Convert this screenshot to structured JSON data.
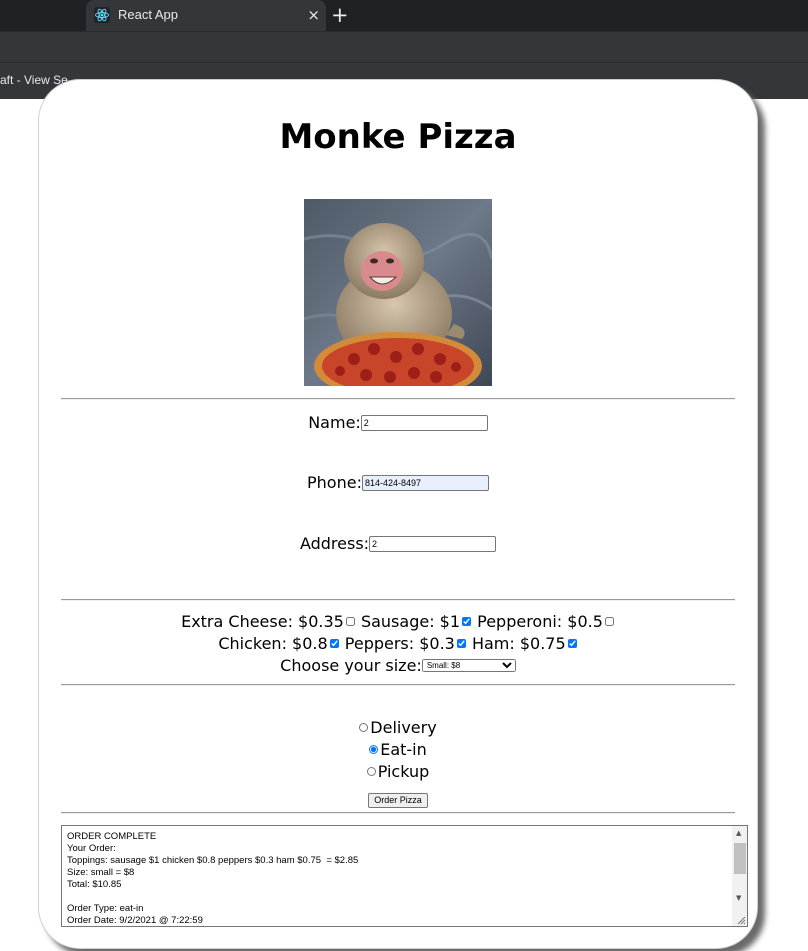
{
  "browser": {
    "tab_title": "React App",
    "tab_close": "×",
    "new_tab": "+",
    "bookmark": "craft - View Se..."
  },
  "page": {
    "title": "Monke Pizza",
    "form": {
      "name_label": "Name:",
      "name_value": "2",
      "phone_label": "Phone:",
      "phone_value": "814-424-8497",
      "address_label": "Address:",
      "address_value": "2"
    },
    "toppings": [
      {
        "label": "Extra Cheese: $0.35",
        "checked": false
      },
      {
        "label": "Sausage: $1",
        "checked": true
      },
      {
        "label": "Pepperoni: $0.5",
        "checked": false
      },
      {
        "label": "Chicken: $0.8",
        "checked": true
      },
      {
        "label": "Peppers: $0.3",
        "checked": true
      },
      {
        "label": "Ham: $0.75",
        "checked": true
      }
    ],
    "size": {
      "label": "Choose your size:",
      "selected": "Small: $8"
    },
    "order_types": [
      {
        "label": "Delivery",
        "checked": false
      },
      {
        "label": "Eat-in",
        "checked": true
      },
      {
        "label": "Pickup",
        "checked": false
      }
    ],
    "order_button": "Order Pizza",
    "summary": "ORDER COMPLETE\nYour Order:\nToppings: sausage $1 chicken $0.8 peppers $0.3 ham $0.75  = $2.85\nSize: small = $8\nTotal: $10.85\n\nOrder Type: eat-in\nOrder Date: 9/2/2021 @ 7:22:59"
  },
  "colors": {
    "tabstrip": "#202124",
    "toolbar": "#35363a",
    "checkbox_accent": "#1a73e8",
    "autofill": "#e8f0fe"
  },
  "icons": {
    "favicon": "react-logo-icon",
    "tab_close": "close-icon",
    "new_tab": "plus-icon"
  }
}
